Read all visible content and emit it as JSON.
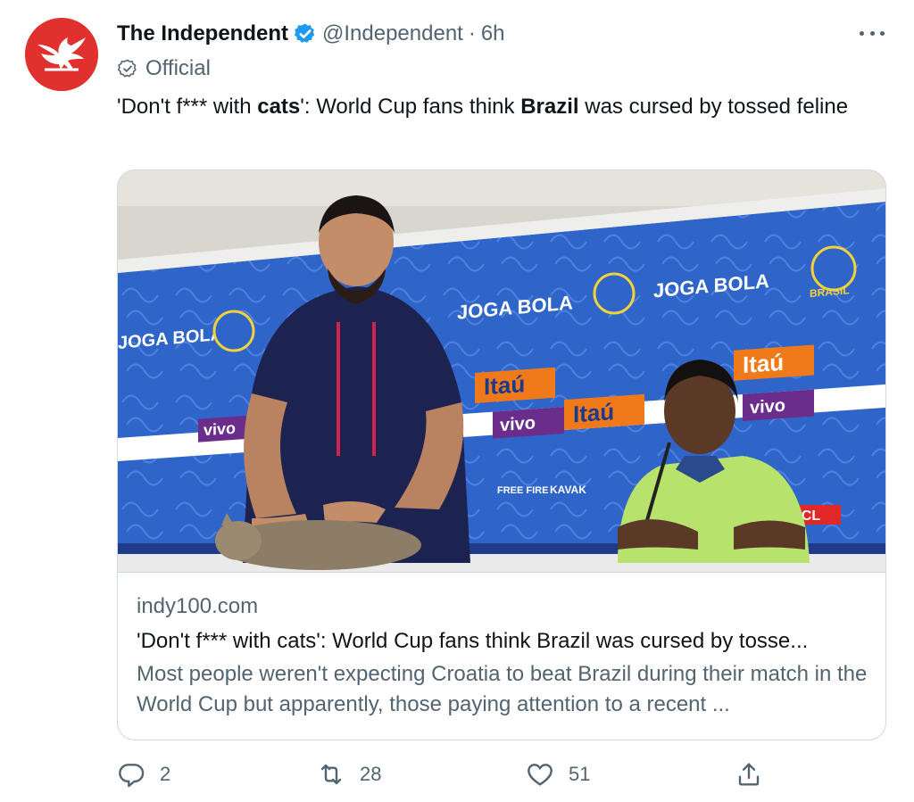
{
  "account": {
    "name": "The Independent",
    "handle": "@Independent",
    "separator": "·",
    "time": "6h",
    "label": "Official",
    "avatar_icon": "eagle-logo-icon",
    "brand_color": "#e0312e",
    "verified_color": "#1d9bf0"
  },
  "tweet": {
    "text_parts": [
      {
        "text": "'Don't f*** with ",
        "bold": false
      },
      {
        "text": "cats",
        "bold": true
      },
      {
        "text": "': World Cup fans think ",
        "bold": false
      },
      {
        "text": "Brazil",
        "bold": true
      },
      {
        "text": " was cursed by tossed feline",
        "bold": false
      }
    ]
  },
  "card": {
    "image_alt": "Press conference photo with cat on table",
    "domain": "indy100.com",
    "title": "'Don't f*** with cats': World Cup fans think Brazil was cursed by tosse...",
    "description": "Most people weren't expecting Croatia to beat Brazil during their match in the World Cup but apparently, those paying attention to a recent ...",
    "backdrop_text": {
      "joga_bola": "JOGA BOLA",
      "brasil": "BRASIL",
      "itau": "Itaú",
      "vivo": "vivo",
      "tcl": "TCL",
      "kavak": "KAVAK",
      "freefire": "FREE FIRE"
    }
  },
  "actions": {
    "reply": {
      "icon": "reply-icon",
      "count": "2"
    },
    "retweet": {
      "icon": "retweet-icon",
      "count": "28"
    },
    "like": {
      "icon": "heart-icon",
      "count": "51"
    },
    "share": {
      "icon": "share-icon"
    }
  }
}
